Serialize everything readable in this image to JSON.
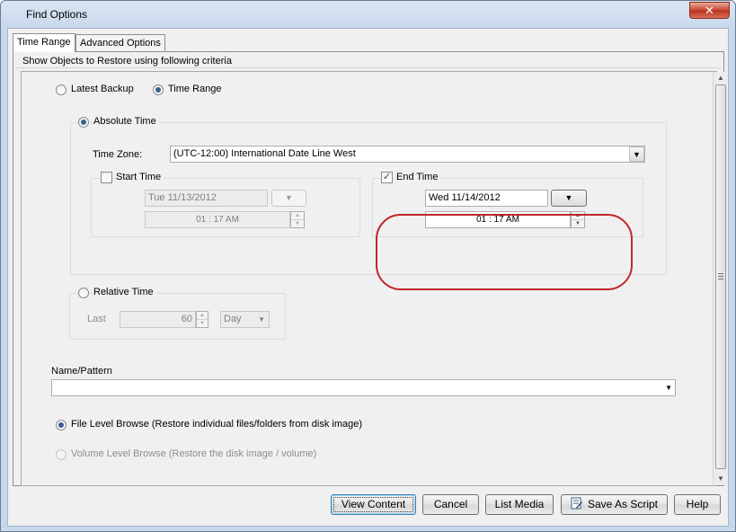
{
  "window": {
    "title": "Find Options",
    "close_label": "✕"
  },
  "tabs": [
    {
      "label": "Time Range",
      "active": true
    },
    {
      "label": "Advanced Options",
      "active": false
    }
  ],
  "panel": {
    "caption": "Show Objects to Restore using following criteria"
  },
  "mode_options": {
    "latest_backup": "Latest Backup",
    "time_range": "Time Range",
    "selected": "time_range"
  },
  "absolute": {
    "label": "Absolute Time",
    "selected": true,
    "timezone_label": "Time Zone:",
    "timezone_value": "(UTC-12:00) International Date Line West",
    "start": {
      "label": "Start Time",
      "checked": false,
      "date": "Tue 11/13/2012",
      "time": "01 : 17 AM"
    },
    "end": {
      "label": "End Time",
      "checked": true,
      "date": "Wed 11/14/2012",
      "time": "01 : 17 AM"
    }
  },
  "relative": {
    "label": "Relative Time",
    "last_label": "Last",
    "last_value": "60",
    "unit": "Day"
  },
  "name_pattern": {
    "label": "Name/Pattern",
    "value": ""
  },
  "browse": {
    "file_level": "File Level Browse (Restore individual files/folders from disk image)",
    "volume_level": "Volume Level Browse (Restore the disk image / volume)",
    "selected": "file_level"
  },
  "buttons": {
    "view_content": "View Content",
    "cancel": "Cancel",
    "list_media": "List Media",
    "save_as_script": "Save As Script",
    "help": "Help"
  },
  "colors": {
    "highlight": "#c0262a",
    "accent": "#3a5f8f"
  },
  "icons": {
    "close": "close-icon",
    "combo_arrow": "dropdown-arrow-icon",
    "script": "script-icon"
  }
}
